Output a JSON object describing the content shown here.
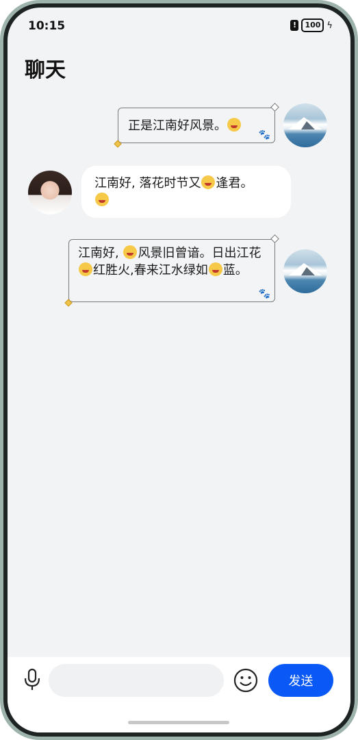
{
  "status_bar": {
    "time": "10:15",
    "alert": "!",
    "battery": "100"
  },
  "header": {
    "title": "聊天"
  },
  "messages": [
    {
      "side": "right",
      "style": "framed",
      "parts": [
        "正是江南好风景。"
      ],
      "emoji": [
        "smiling-face"
      ],
      "avatar": "landscape"
    },
    {
      "side": "left",
      "style": "white",
      "parts": [
        "江南好, 落花时节又",
        "逢君。"
      ],
      "emoji": [
        "grinning-face",
        "smiling-face"
      ],
      "avatar": "woman"
    },
    {
      "side": "right",
      "style": "framed",
      "parts": [
        "江南好, ",
        "风景旧曾谙。日出江花",
        "红胜火,春来江水绿如",
        "蓝。"
      ],
      "emoji": [
        "kissing-face",
        "grinning-face",
        "kissing-face"
      ],
      "avatar": "landscape"
    }
  ],
  "composer": {
    "input_value": "",
    "send_label": "发送"
  },
  "colors": {
    "accent": "#0a59f7",
    "background": "#f1f3f5",
    "bubble_white": "#ffffff"
  }
}
